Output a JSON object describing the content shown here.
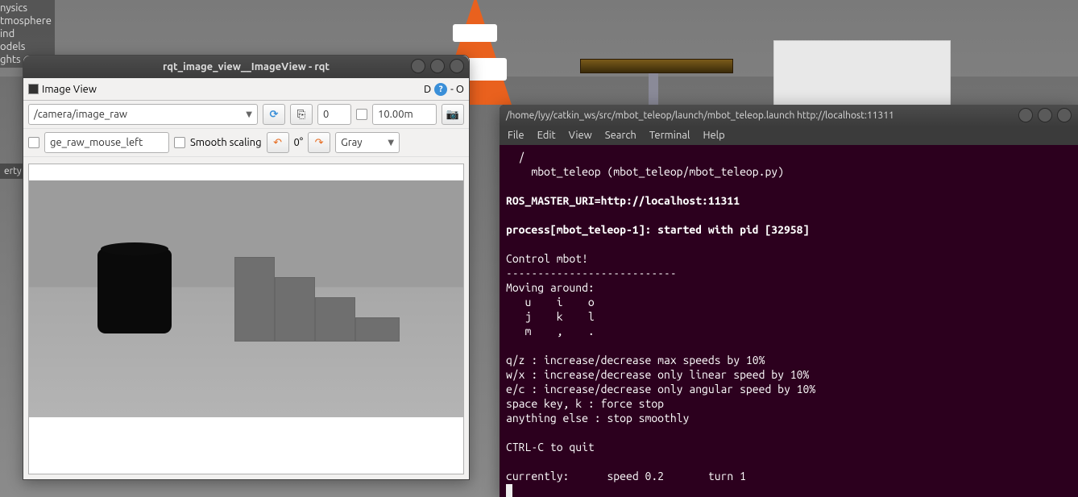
{
  "background": {
    "tree_items": [
      "nysics",
      "tmosphere",
      "ind",
      "odels",
      "ghts"
    ],
    "property_tab": "erty"
  },
  "rqt": {
    "title": "rqt_image_view__ImageView - rqt",
    "panel": {
      "label": "Image View",
      "d_label": "D",
      "maximize_label": "- O"
    },
    "row1": {
      "topic": "/camera/image_raw",
      "num": "0",
      "distance": "10.00m"
    },
    "row2": {
      "mouse_topic": "ge_raw_mouse_left",
      "smooth_label": "Smooth scaling",
      "angle": "0°",
      "color": "Gray"
    }
  },
  "terminal": {
    "title": "/home/lyy/catkin_ws/src/mbot_teleop/launch/mbot_teleop.launch http://localhost:11311",
    "menu": [
      "File",
      "Edit",
      "View",
      "Search",
      "Terminal",
      "Help"
    ],
    "lines": {
      "l1": "  /",
      "l2": "    mbot_teleop (mbot_teleop/mbot_teleop.py)",
      "l3": "",
      "l4": "ROS_MASTER_URI=http://localhost:11311",
      "l5": "",
      "l6": "process[mbot_teleop-1]: started with pid [32958]",
      "l7": "",
      "l8": "Control mbot!",
      "l9": "---------------------------",
      "l10": "Moving around:",
      "l11": "   u    i    o",
      "l12": "   j    k    l",
      "l13": "   m    ,    .",
      "l14": "",
      "l15": "q/z : increase/decrease max speeds by 10%",
      "l16": "w/x : increase/decrease only linear speed by 10%",
      "l17": "e/c : increase/decrease only angular speed by 10%",
      "l18": "space key, k : force stop",
      "l19": "anything else : stop smoothly",
      "l20": "",
      "l21": "CTRL-C to quit",
      "l22": "",
      "l23": "currently:\tspeed 0.2\tturn 1"
    }
  }
}
